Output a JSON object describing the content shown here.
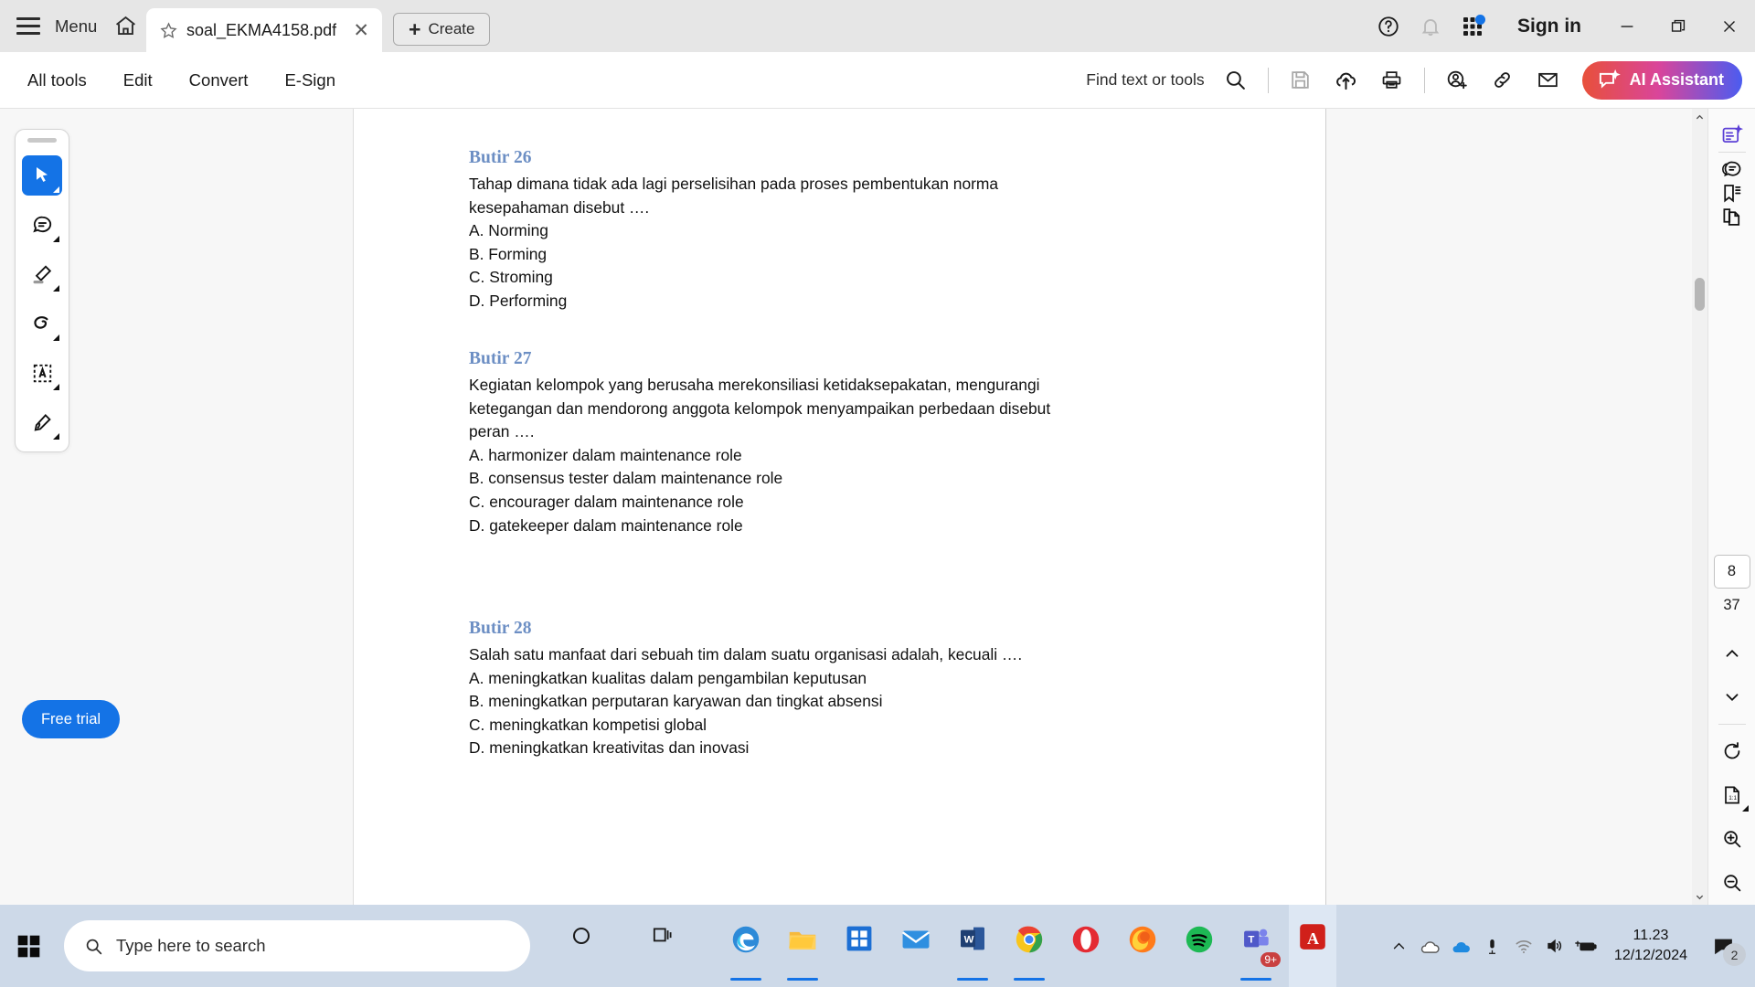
{
  "titlebar": {
    "menu_label": "Menu",
    "home_icon": "home-icon",
    "tab_title": "soal_EKMA4158.pdf",
    "tab_star_icon": "star-icon",
    "tab_close_icon": "close-icon",
    "create_label": "Create",
    "create_plus": "+",
    "help_icon": "help-circle-icon",
    "bell_icon": "bell-icon",
    "apps_icon": "app-grid-icon",
    "signin_label": "Sign in",
    "minimize_icon": "minimize-icon",
    "restore_icon": "restore-icon",
    "close_icon": "close-icon"
  },
  "toolbar": {
    "tabs": [
      {
        "label": "All tools"
      },
      {
        "label": "Edit"
      },
      {
        "label": "Convert"
      },
      {
        "label": "E-Sign"
      }
    ],
    "find_label": "Find text or tools",
    "search_icon": "search-icon",
    "save_icon": "save-icon",
    "upload_icon": "cloud-upload-icon",
    "print_icon": "print-icon",
    "share_person_icon": "add-person-icon",
    "link_icon": "link-icon",
    "mail_icon": "mail-icon",
    "ai_label": "AI Assistant",
    "ai_icon": "ai-sparkle-icon",
    "ai_gradient_from": "#e8503a",
    "ai_gradient_to": "#4b5cf0"
  },
  "left_rail": {
    "tools": [
      {
        "name": "select-tool-icon",
        "active": true
      },
      {
        "name": "comment-tool-icon",
        "active": false
      },
      {
        "name": "highlight-tool-icon",
        "active": false
      },
      {
        "name": "draw-tool-icon",
        "active": false
      },
      {
        "name": "text-select-tool-icon",
        "active": false
      },
      {
        "name": "signature-tool-icon",
        "active": false
      }
    ],
    "free_trial_label": "Free trial",
    "free_trial_color": "#1473e6"
  },
  "document": {
    "heading_color": "#6d8fc4",
    "questions": [
      {
        "number": "Butir 26",
        "lines": [
          "Tahap dimana tidak ada lagi perselisihan pada proses pembentukan norma",
          "kesepahaman disebut ….",
          "A. Norming",
          "B. Forming",
          "C. Stroming",
          "D. Performing"
        ]
      },
      {
        "number": "Butir 27",
        "lines": [
          "Kegiatan kelompok yang berusaha merekonsiliasi ketidaksepakatan, mengurangi",
          "ketegangan dan mendorong anggota kelompok menyampaikan perbedaan disebut",
          "peran ….",
          "A. harmonizer  dalam maintenance role",
          "B. consensus tester  dalam maintenance role",
          "C. encourager dalam maintenance role",
          "D. gatekeeper dalam maintenance role"
        ]
      },
      {
        "number": "Butir 28",
        "lines": [
          "Salah satu manfaat dari sebuah tim dalam suatu organisasi adalah, kecuali ….",
          "A. meningkatkan kualitas dalam pengambilan keputusan",
          "B. meningkatkan perputaran karyawan dan tingkat absensi",
          "C. meningkatkan kompetisi global",
          "D. meningkatkan kreativitas dan inovasi"
        ]
      }
    ]
  },
  "right_rail": {
    "top_icons": [
      {
        "name": "ai-summary-icon"
      },
      {
        "name": "comment-panel-icon"
      },
      {
        "name": "bookmark-icon"
      },
      {
        "name": "organize-pages-icon"
      }
    ],
    "current_page": "8",
    "total_pages": "37",
    "prev_page_icon": "chevron-up-icon",
    "next_page_icon": "chevron-down-icon",
    "rotate_icon": "rotate-icon",
    "fit_icon": "fit-page-icon",
    "zoom_in_icon": "zoom-in-icon",
    "zoom_out_icon": "zoom-out-icon"
  },
  "taskbar": {
    "start_icon": "windows-start-icon",
    "search_icon": "search-icon",
    "search_placeholder": "Type here to search",
    "cortana_icon": "cortana-circle-icon",
    "taskview_icon": "task-view-icon",
    "apps": [
      {
        "name": "edge-icon"
      },
      {
        "name": "file-explorer-icon"
      },
      {
        "name": "microsoft-store-icon"
      },
      {
        "name": "mail-icon"
      },
      {
        "name": "word-icon"
      },
      {
        "name": "chrome-icon"
      },
      {
        "name": "opera-icon"
      },
      {
        "name": "firefox-icon"
      },
      {
        "name": "spotify-icon"
      },
      {
        "name": "teams-icon"
      },
      {
        "name": "acrobat-icon"
      }
    ],
    "teams_badge": "9+",
    "tray": [
      {
        "name": "show-hidden-icons-icon"
      },
      {
        "name": "onedrive-gray-icon"
      },
      {
        "name": "onedrive-blue-icon"
      },
      {
        "name": "microphone-icon"
      },
      {
        "name": "wifi-icon"
      },
      {
        "name": "volume-icon"
      },
      {
        "name": "battery-charging-icon"
      }
    ],
    "time": "11.23",
    "date": "12/12/2024",
    "notification_icon": "notification-icon",
    "notification_count": "2"
  }
}
